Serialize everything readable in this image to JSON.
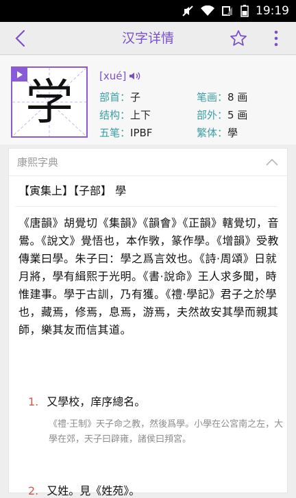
{
  "status_bar": {
    "time": "19:19"
  },
  "app_bar": {
    "title": "汉字详情"
  },
  "character": {
    "glyph": "学",
    "pinyin": "[xué]",
    "radical_label": "部首：",
    "radical": "子",
    "strokes_label": "笔画：",
    "strokes": "8 画",
    "structure_label": "结构：",
    "structure": "上下",
    "outer_strokes_label": "部外：",
    "outer_strokes": "5 画",
    "wubi_label": "五笔：",
    "wubi": "IPBF",
    "traditional_label": "繁体：",
    "traditional": "學"
  },
  "kangxi": {
    "title": "康熙字典",
    "heading": "【寅集上】【子部】 學",
    "body": "《唐韻》胡覺切《集韻》《韻會》《正韻》轄覺切，音鷽。《說文》覺悟也，本作斆，篆作學。《增韻》受教傳業曰學。朱子曰：學之爲言效也。《詩·周頌》日就月將，學有緝熙于光明。《書·說命》王人求多聞，時惟建事。學于古訓，乃有獲。《禮·學記》君子之於學也，藏焉，修焉，息焉，游焉，夫然故安其學而親其師，樂其友而信其道。",
    "definitions": [
      {
        "num": "1.",
        "text": "又學校，庠序總名。",
        "quote": "《禮·王制》天子命之教，然後爲學。小學在公宮南之左，大學在郊，天子曰辟雍，諸侯曰頖宮。"
      },
      {
        "num": "2.",
        "text": "又姓。見《姓苑》。"
      }
    ]
  }
}
